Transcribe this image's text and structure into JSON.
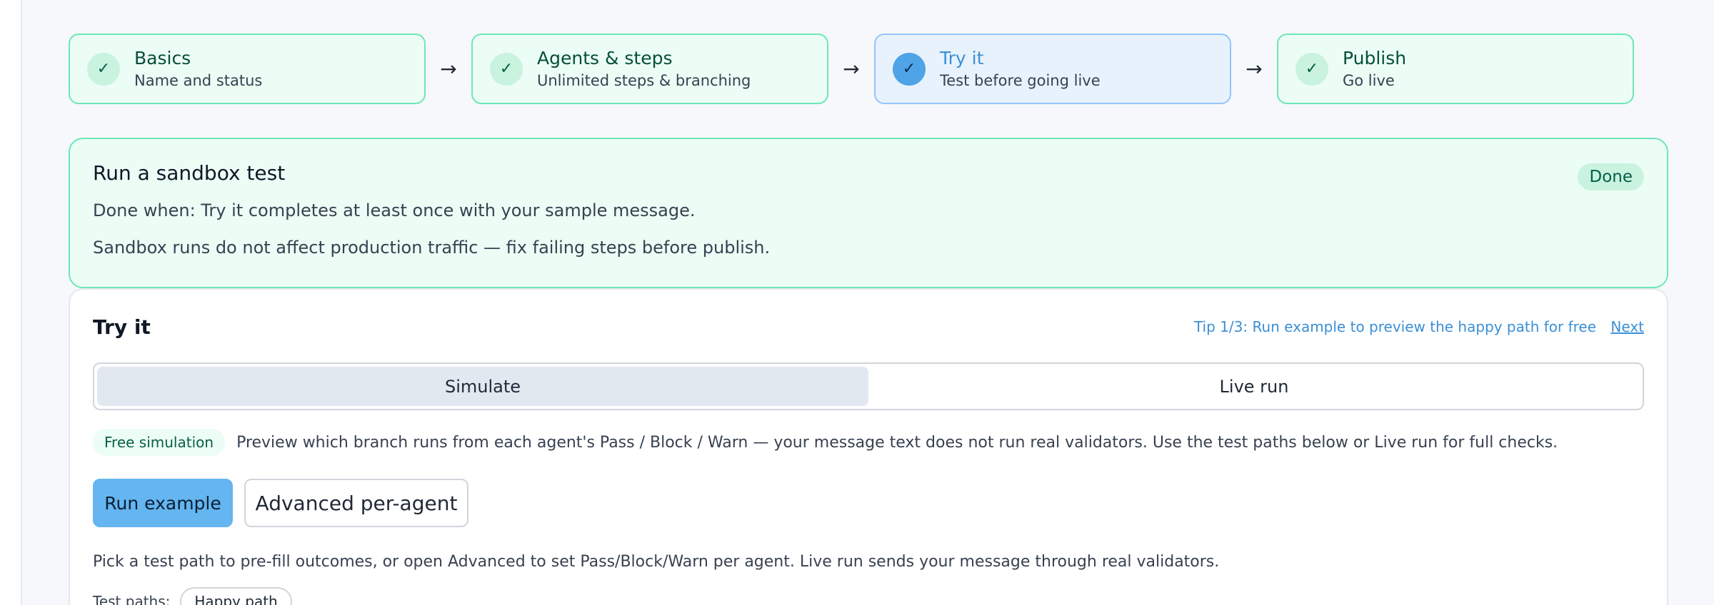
{
  "stepper": {
    "steps": [
      {
        "title": "Basics",
        "subtitle": "Name and status",
        "check": "✓",
        "state": "complete"
      },
      {
        "title": "Agents & steps",
        "subtitle": "Unlimited steps & branching",
        "check": "✓",
        "state": "complete"
      },
      {
        "title": "Try it",
        "subtitle": "Test before going live",
        "check": "✓",
        "state": "current"
      },
      {
        "title": "Publish",
        "subtitle": "Go live",
        "check": "✓",
        "state": "complete"
      }
    ],
    "arrow": "→"
  },
  "task": {
    "title": "Run a sandbox test",
    "status": "Done",
    "done_when": "Done when: Try it completes at least once with your sample message.",
    "note": "Sandbox runs do not affect production traffic — fix failing steps before publish."
  },
  "try_it": {
    "title": "Try it",
    "tip": "Tip 1/3: Run example to preview the happy path for free",
    "tip_next": "Next",
    "modes": [
      {
        "label": "Simulate",
        "active": true
      },
      {
        "label": "Live run",
        "active": false
      }
    ],
    "free_badge": "Free simulation",
    "info": "Preview which branch runs from each agent's Pass / Block / Warn — your message text does not run real validators. Use the test paths below or Live run for full checks.",
    "run_example": "Run example",
    "advanced": "Advanced per-agent",
    "help": "Pick a test path to pre-fill outcomes, or open Advanced to set Pass/Block/Warn per agent. Live run sends your message through real validators.",
    "test_paths_label": "Test paths:",
    "test_paths": [
      "Happy path"
    ]
  },
  "icons": {
    "check": "check-icon",
    "arrow": "arrow-right-icon"
  },
  "colors": {
    "complete_border": "#6ee7b7",
    "complete_bg": "#ecfdf5",
    "current_border": "#93c5fd",
    "current_bg": "#e8f2fc",
    "primary": "#64b5f0",
    "link": "#3b8fd6"
  }
}
